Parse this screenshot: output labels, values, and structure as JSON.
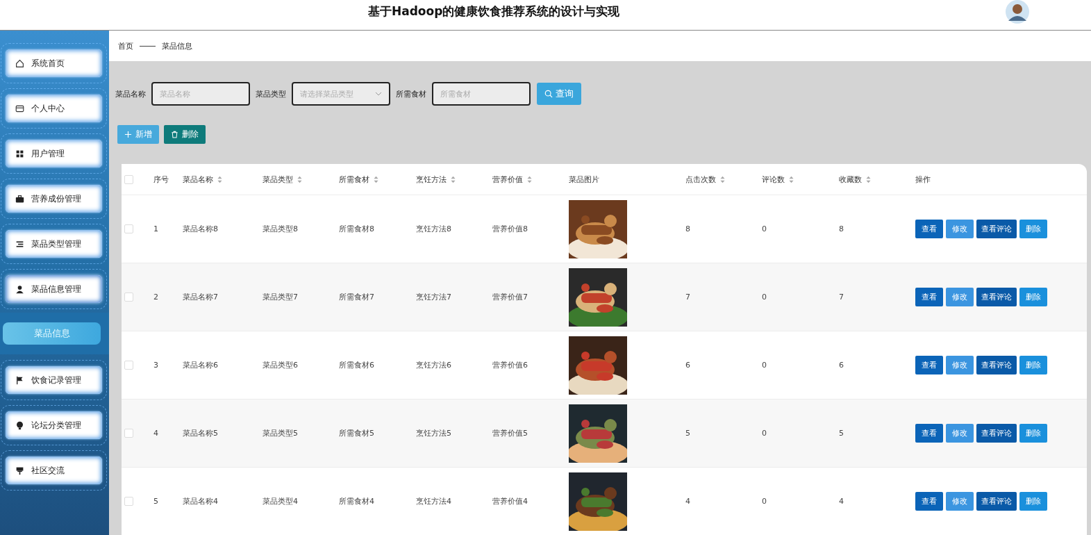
{
  "header": {
    "title": "基于Hadoop的健康饮食推荐系统的设计与实现",
    "avatar": {
      "kind": "picture"
    }
  },
  "sidebar": {
    "items": [
      {
        "label": "系统首页",
        "expanded": false
      },
      {
        "label": "个人中心",
        "expanded": false
      },
      {
        "label": "用户管理",
        "expanded": false
      },
      {
        "label": "营养成份管理",
        "expanded": false
      },
      {
        "label": "菜品类型管理",
        "expanded": false
      },
      {
        "label": "菜品信息管理",
        "expanded": true,
        "children": [
          {
            "label": "菜品信息",
            "selected": true
          }
        ]
      },
      {
        "label": "饮食记录管理",
        "expanded": false
      },
      {
        "label": "论坛分类管理",
        "expanded": false
      },
      {
        "label": "社区交流",
        "expanded": false
      }
    ]
  },
  "breadcrumb": [
    "首页",
    "菜品信息"
  ],
  "search": {
    "fields": [
      {
        "kind": "input",
        "label": "菜品名称",
        "placeholder": "菜品名称"
      },
      {
        "kind": "select",
        "label": "菜品类型",
        "placeholder": "请选择菜品类型"
      },
      {
        "kind": "input",
        "label": "所需食材",
        "placeholder": "所需食材"
      }
    ],
    "button": "查询"
  },
  "actions": [
    {
      "kind": "add",
      "label": "新增"
    },
    {
      "kind": "delete",
      "label": "删除"
    }
  ],
  "table": {
    "header_checked": false,
    "columns": [
      {
        "label": "序号",
        "sortable": false
      },
      {
        "label": "菜品名称",
        "sortable": true
      },
      {
        "label": "菜品类型",
        "sortable": true
      },
      {
        "label": "所需食材",
        "sortable": true
      },
      {
        "label": "烹饪方法",
        "sortable": true
      },
      {
        "label": "营养价值",
        "sortable": true
      },
      {
        "label": "菜品图片",
        "sortable": false
      },
      {
        "label": "点击次数",
        "sortable": true
      },
      {
        "label": "评论数",
        "sortable": true
      },
      {
        "label": "收藏数",
        "sortable": true
      },
      {
        "label": "操作",
        "sortable": false
      }
    ],
    "rows": [
      {
        "checked": false,
        "cells": [
          "1",
          "菜品名称8",
          "菜品类型8",
          "所需食材8",
          "烹饪方法8",
          "营养价值8"
        ],
        "image": {
          "kind": "picture"
        },
        "counts": [
          "8",
          "0",
          "8"
        ],
        "buttons": [
          "查看",
          "修改",
          "查看评论",
          "删除"
        ]
      },
      {
        "checked": false,
        "cells": [
          "2",
          "菜品名称7",
          "菜品类型7",
          "所需食材7",
          "烹饪方法7",
          "营养价值7"
        ],
        "image": {
          "kind": "picture"
        },
        "counts": [
          "7",
          "0",
          "7"
        ],
        "buttons": [
          "查看",
          "修改",
          "查看评论",
          "删除"
        ]
      },
      {
        "checked": false,
        "cells": [
          "3",
          "菜品名称6",
          "菜品类型6",
          "所需食材6",
          "烹饪方法6",
          "营养价值6"
        ],
        "image": {
          "kind": "picture"
        },
        "counts": [
          "6",
          "0",
          "6"
        ],
        "buttons": [
          "查看",
          "修改",
          "查看评论",
          "删除"
        ]
      },
      {
        "checked": false,
        "cells": [
          "4",
          "菜品名称5",
          "菜品类型5",
          "所需食材5",
          "烹饪方法5",
          "营养价值5"
        ],
        "image": {
          "kind": "picture"
        },
        "counts": [
          "5",
          "0",
          "5"
        ],
        "buttons": [
          "查看",
          "修改",
          "查看评论",
          "删除"
        ]
      },
      {
        "checked": false,
        "cells": [
          "5",
          "菜品名称4",
          "菜品类型4",
          "所需食材4",
          "烹饪方法4",
          "营养价值4"
        ],
        "image": {
          "kind": "picture"
        },
        "counts": [
          "4",
          "0",
          "4"
        ],
        "buttons": [
          "查看",
          "修改",
          "查看评论",
          "删除"
        ]
      }
    ]
  }
}
